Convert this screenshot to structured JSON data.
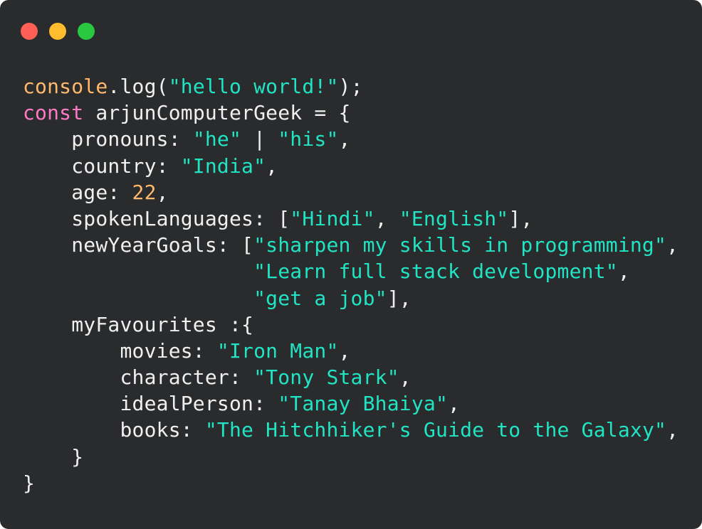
{
  "window": {
    "controls": [
      {
        "name": "close-button",
        "color": "#ff5f57"
      },
      {
        "name": "minimize-button",
        "color": "#febc2e"
      },
      {
        "name": "maximize-button",
        "color": "#28c840"
      }
    ]
  },
  "colors": {
    "background": "#2a2b2d",
    "plain": "#f0f0f0",
    "string": "#21e4c4",
    "number": "#ffb86c",
    "keyword": "#ff79c6",
    "builtin": "#ffb86c"
  },
  "code": {
    "lines": [
      [
        {
          "t": "builtin",
          "v": "console"
        },
        {
          "t": "plain",
          "v": ".log("
        },
        {
          "t": "string",
          "v": "\"hello world!\""
        },
        {
          "t": "plain",
          "v": ");"
        }
      ],
      [
        {
          "t": "keyword",
          "v": "const"
        },
        {
          "t": "plain",
          "v": " arjunComputerGeek = {"
        }
      ],
      [
        {
          "t": "plain",
          "v": "    pronouns: "
        },
        {
          "t": "string",
          "v": "\"he\""
        },
        {
          "t": "plain",
          "v": " | "
        },
        {
          "t": "string",
          "v": "\"his\""
        },
        {
          "t": "plain",
          "v": ","
        }
      ],
      [
        {
          "t": "plain",
          "v": "    country: "
        },
        {
          "t": "string",
          "v": "\"India\""
        },
        {
          "t": "plain",
          "v": ","
        }
      ],
      [
        {
          "t": "plain",
          "v": "    age: "
        },
        {
          "t": "number",
          "v": "22"
        },
        {
          "t": "plain",
          "v": ","
        }
      ],
      [
        {
          "t": "plain",
          "v": "    spokenLanguages: ["
        },
        {
          "t": "string",
          "v": "\"Hindi\""
        },
        {
          "t": "plain",
          "v": ", "
        },
        {
          "t": "string",
          "v": "\"English\""
        },
        {
          "t": "plain",
          "v": "],"
        }
      ],
      [
        {
          "t": "plain",
          "v": "    newYearGoals: ["
        },
        {
          "t": "string",
          "v": "\"sharpen my skills in programming\""
        },
        {
          "t": "plain",
          "v": ","
        }
      ],
      [
        {
          "t": "plain",
          "v": "                   "
        },
        {
          "t": "string",
          "v": "\"Learn full stack development\""
        },
        {
          "t": "plain",
          "v": ","
        }
      ],
      [
        {
          "t": "plain",
          "v": "                   "
        },
        {
          "t": "string",
          "v": "\"get a job\""
        },
        {
          "t": "plain",
          "v": "],"
        }
      ],
      [
        {
          "t": "plain",
          "v": "    myFavourites :{"
        }
      ],
      [
        {
          "t": "plain",
          "v": "        movies: "
        },
        {
          "t": "string",
          "v": "\"Iron Man\""
        },
        {
          "t": "plain",
          "v": ","
        }
      ],
      [
        {
          "t": "plain",
          "v": "        character: "
        },
        {
          "t": "string",
          "v": "\"Tony Stark\""
        },
        {
          "t": "plain",
          "v": ","
        }
      ],
      [
        {
          "t": "plain",
          "v": "        idealPerson: "
        },
        {
          "t": "string",
          "v": "\"Tanay Bhaiya\""
        },
        {
          "t": "plain",
          "v": ","
        }
      ],
      [
        {
          "t": "plain",
          "v": "        books: "
        },
        {
          "t": "string",
          "v": "\"The Hitchhiker's Guide to the Galaxy\""
        },
        {
          "t": "plain",
          "v": ","
        }
      ],
      [
        {
          "t": "plain",
          "v": "    }"
        }
      ],
      [
        {
          "t": "plain",
          "v": "}"
        }
      ]
    ]
  }
}
